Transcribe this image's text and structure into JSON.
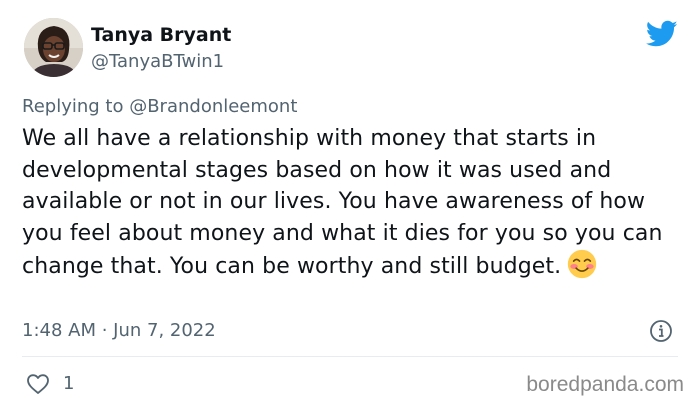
{
  "tweet": {
    "author": {
      "name": "Tanya Bryant",
      "handle": "@TanyaBTwin1"
    },
    "reply_to": "Replying to @Brandonleemont",
    "text": "We all have a relationship with money that starts in developmental stages based on how it was used and available or not in our lives. You have awareness of how you feel about money and what it dies for you so you can change that. You can be worthy and still budget.",
    "emoji": "smiling-face-with-blush-emoji",
    "timestamp": "1:48 AM · Jun 7, 2022",
    "likes": "1"
  },
  "icons": {
    "brand": "twitter-bird-icon",
    "info": "info-icon",
    "like": "heart-icon"
  },
  "colors": {
    "twitter_blue": "#1d9bf0",
    "text_primary": "#0f1419",
    "text_secondary": "#536471",
    "divider": "#e6ecf0"
  },
  "watermark": "boredpanda.com"
}
